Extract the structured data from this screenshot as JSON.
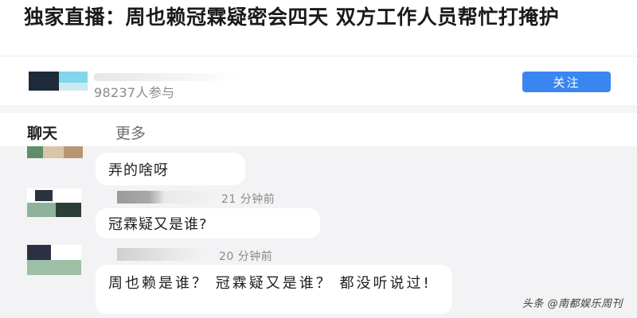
{
  "article": {
    "title": "独家直播：周也赖冠霖疑密会四天 双方工作人员帮忙打掩护"
  },
  "host": {
    "participants": "98237人参与",
    "follow_label": "关注"
  },
  "tabs": {
    "chat": "聊天",
    "more": "更多"
  },
  "messages": [
    {
      "text": "弄的啥呀",
      "time": ""
    },
    {
      "text": "冠霖疑又是谁?",
      "time": "21 分钟前"
    },
    {
      "text": "周也赖是谁？ 冠霖疑又是谁？ 都没听说过!",
      "time": "20 分钟前"
    }
  ],
  "watermark": "头条 @南都娱乐周刊",
  "colors": {
    "accent": "#3a86f0",
    "chat_background": "#f3f3f5",
    "bubble": "#ffffff"
  }
}
